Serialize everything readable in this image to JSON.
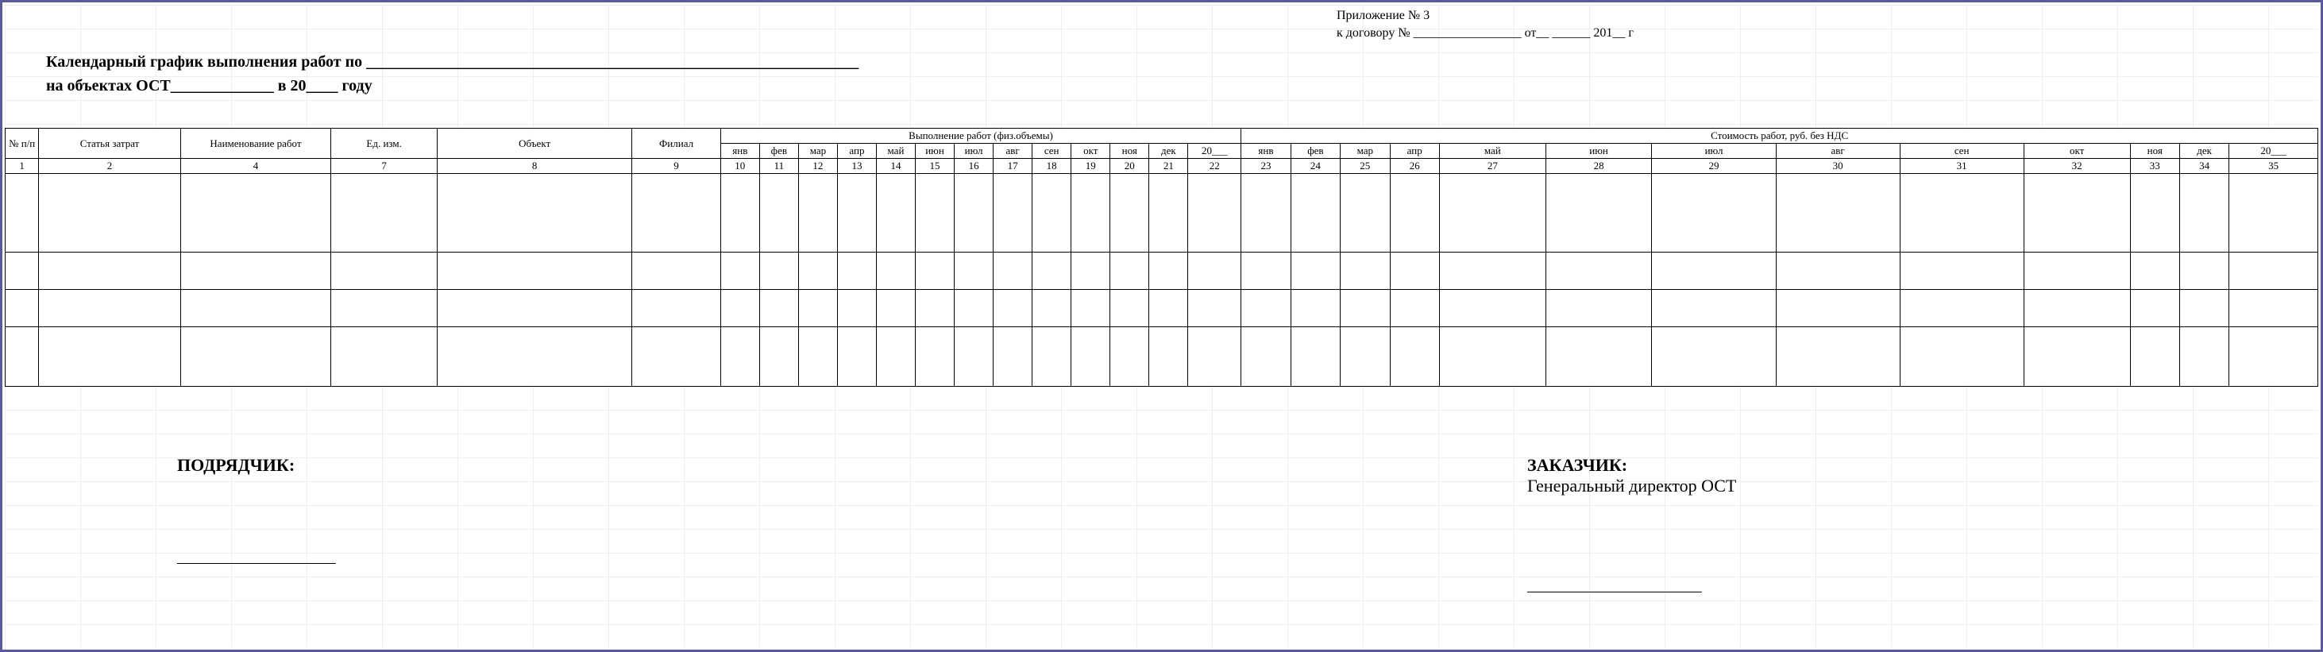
{
  "appendix": {
    "line1": "Приложение № 3",
    "line2": "к договору № _________________  от__  ______ 201__  г"
  },
  "title": {
    "line1": "Календарный график выполнения работ по ______________________________________________________________",
    "line2": "на объектах ОСТ_____________  в 20____ году"
  },
  "group_headers": {
    "volume": "Выполнение работ (физ.объемы)",
    "cost": "Стоимость работ,  руб. без НДС"
  },
  "headers": {
    "c1": "№ п/п",
    "c2": "Статья затрат",
    "c4": "Наименование работ",
    "c7": "Ед. изм.",
    "c8": "Объект",
    "c9": "Филиал"
  },
  "months": {
    "jan": "янв",
    "feb": "фев",
    "mar": "мар",
    "apr": "апр",
    "may": "май",
    "jun": "июн",
    "jul": "июл",
    "aug": "авг",
    "sep": "сен",
    "oct": "окт",
    "nov": "ноя",
    "dec": "дек"
  },
  "year_col": "20___",
  "col_numbers": [
    "1",
    "2",
    "4",
    "7",
    "8",
    "9",
    "10",
    "11",
    "12",
    "13",
    "14",
    "15",
    "16",
    "17",
    "18",
    "19",
    "20",
    "21",
    "22",
    "23",
    "24",
    "25",
    "26",
    "27",
    "28",
    "29",
    "30",
    "31",
    "32",
    "33",
    "34",
    "35"
  ],
  "footer": {
    "contractor": "ПОДРЯДЧИК:",
    "customer": "ЗАКАЗЧИК:",
    "customer_sub": "Генеральный директор ОСТ"
  }
}
